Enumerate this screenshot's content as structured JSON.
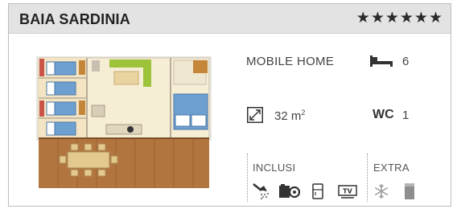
{
  "header": {
    "title": "BAIA SARDINIA",
    "stars": "★★★★★★"
  },
  "details": {
    "type_label": "MOBILE HOME",
    "beds": "6",
    "area_value": "32 m",
    "area_sup": "2",
    "wc_label": "WC",
    "wc_count": "1"
  },
  "services": {
    "included_label": "INCLUSI",
    "extra_label": "EXTRA",
    "included_icons": [
      "shower-icon",
      "gas-stove-icon",
      "fridge-icon",
      "tv-icon"
    ],
    "extra_icons": [
      "air-conditioning-icon",
      "bedding-icon"
    ]
  },
  "colors": {
    "header_bg": "#e3e3e3",
    "deck": "#b2753f",
    "bed_blue": "#6d9fd0",
    "sofa_green": "#9cc33a",
    "floor": "#f6edd5"
  }
}
